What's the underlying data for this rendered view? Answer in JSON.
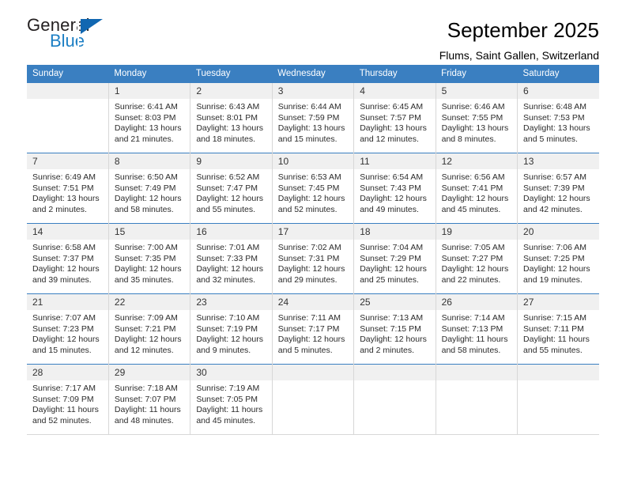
{
  "brand": {
    "name_part1": "General",
    "name_part2": "Blue",
    "accent_color": "#1167b1",
    "blue_text_color": "#1c7fc4"
  },
  "header": {
    "title": "September 2025",
    "subtitle": "Flums, Saint Gallen, Switzerland"
  },
  "calendar": {
    "header_bg": "#3a7fc1",
    "daynum_bg": "#f0f0f0",
    "weekday_headers": [
      "Sunday",
      "Monday",
      "Tuesday",
      "Wednesday",
      "Thursday",
      "Friday",
      "Saturday"
    ],
    "weeks": [
      [
        {
          "day": "",
          "sunrise": "",
          "sunset": "",
          "daylight_line1": "",
          "daylight_line2": ""
        },
        {
          "day": "1",
          "sunrise": "Sunrise: 6:41 AM",
          "sunset": "Sunset: 8:03 PM",
          "daylight_line1": "Daylight: 13 hours",
          "daylight_line2": "and 21 minutes."
        },
        {
          "day": "2",
          "sunrise": "Sunrise: 6:43 AM",
          "sunset": "Sunset: 8:01 PM",
          "daylight_line1": "Daylight: 13 hours",
          "daylight_line2": "and 18 minutes."
        },
        {
          "day": "3",
          "sunrise": "Sunrise: 6:44 AM",
          "sunset": "Sunset: 7:59 PM",
          "daylight_line1": "Daylight: 13 hours",
          "daylight_line2": "and 15 minutes."
        },
        {
          "day": "4",
          "sunrise": "Sunrise: 6:45 AM",
          "sunset": "Sunset: 7:57 PM",
          "daylight_line1": "Daylight: 13 hours",
          "daylight_line2": "and 12 minutes."
        },
        {
          "day": "5",
          "sunrise": "Sunrise: 6:46 AM",
          "sunset": "Sunset: 7:55 PM",
          "daylight_line1": "Daylight: 13 hours",
          "daylight_line2": "and 8 minutes."
        },
        {
          "day": "6",
          "sunrise": "Sunrise: 6:48 AM",
          "sunset": "Sunset: 7:53 PM",
          "daylight_line1": "Daylight: 13 hours",
          "daylight_line2": "and 5 minutes."
        }
      ],
      [
        {
          "day": "7",
          "sunrise": "Sunrise: 6:49 AM",
          "sunset": "Sunset: 7:51 PM",
          "daylight_line1": "Daylight: 13 hours",
          "daylight_line2": "and 2 minutes."
        },
        {
          "day": "8",
          "sunrise": "Sunrise: 6:50 AM",
          "sunset": "Sunset: 7:49 PM",
          "daylight_line1": "Daylight: 12 hours",
          "daylight_line2": "and 58 minutes."
        },
        {
          "day": "9",
          "sunrise": "Sunrise: 6:52 AM",
          "sunset": "Sunset: 7:47 PM",
          "daylight_line1": "Daylight: 12 hours",
          "daylight_line2": "and 55 minutes."
        },
        {
          "day": "10",
          "sunrise": "Sunrise: 6:53 AM",
          "sunset": "Sunset: 7:45 PM",
          "daylight_line1": "Daylight: 12 hours",
          "daylight_line2": "and 52 minutes."
        },
        {
          "day": "11",
          "sunrise": "Sunrise: 6:54 AM",
          "sunset": "Sunset: 7:43 PM",
          "daylight_line1": "Daylight: 12 hours",
          "daylight_line2": "and 49 minutes."
        },
        {
          "day": "12",
          "sunrise": "Sunrise: 6:56 AM",
          "sunset": "Sunset: 7:41 PM",
          "daylight_line1": "Daylight: 12 hours",
          "daylight_line2": "and 45 minutes."
        },
        {
          "day": "13",
          "sunrise": "Sunrise: 6:57 AM",
          "sunset": "Sunset: 7:39 PM",
          "daylight_line1": "Daylight: 12 hours",
          "daylight_line2": "and 42 minutes."
        }
      ],
      [
        {
          "day": "14",
          "sunrise": "Sunrise: 6:58 AM",
          "sunset": "Sunset: 7:37 PM",
          "daylight_line1": "Daylight: 12 hours",
          "daylight_line2": "and 39 minutes."
        },
        {
          "day": "15",
          "sunrise": "Sunrise: 7:00 AM",
          "sunset": "Sunset: 7:35 PM",
          "daylight_line1": "Daylight: 12 hours",
          "daylight_line2": "and 35 minutes."
        },
        {
          "day": "16",
          "sunrise": "Sunrise: 7:01 AM",
          "sunset": "Sunset: 7:33 PM",
          "daylight_line1": "Daylight: 12 hours",
          "daylight_line2": "and 32 minutes."
        },
        {
          "day": "17",
          "sunrise": "Sunrise: 7:02 AM",
          "sunset": "Sunset: 7:31 PM",
          "daylight_line1": "Daylight: 12 hours",
          "daylight_line2": "and 29 minutes."
        },
        {
          "day": "18",
          "sunrise": "Sunrise: 7:04 AM",
          "sunset": "Sunset: 7:29 PM",
          "daylight_line1": "Daylight: 12 hours",
          "daylight_line2": "and 25 minutes."
        },
        {
          "day": "19",
          "sunrise": "Sunrise: 7:05 AM",
          "sunset": "Sunset: 7:27 PM",
          "daylight_line1": "Daylight: 12 hours",
          "daylight_line2": "and 22 minutes."
        },
        {
          "day": "20",
          "sunrise": "Sunrise: 7:06 AM",
          "sunset": "Sunset: 7:25 PM",
          "daylight_line1": "Daylight: 12 hours",
          "daylight_line2": "and 19 minutes."
        }
      ],
      [
        {
          "day": "21",
          "sunrise": "Sunrise: 7:07 AM",
          "sunset": "Sunset: 7:23 PM",
          "daylight_line1": "Daylight: 12 hours",
          "daylight_line2": "and 15 minutes."
        },
        {
          "day": "22",
          "sunrise": "Sunrise: 7:09 AM",
          "sunset": "Sunset: 7:21 PM",
          "daylight_line1": "Daylight: 12 hours",
          "daylight_line2": "and 12 minutes."
        },
        {
          "day": "23",
          "sunrise": "Sunrise: 7:10 AM",
          "sunset": "Sunset: 7:19 PM",
          "daylight_line1": "Daylight: 12 hours",
          "daylight_line2": "and 9 minutes."
        },
        {
          "day": "24",
          "sunrise": "Sunrise: 7:11 AM",
          "sunset": "Sunset: 7:17 PM",
          "daylight_line1": "Daylight: 12 hours",
          "daylight_line2": "and 5 minutes."
        },
        {
          "day": "25",
          "sunrise": "Sunrise: 7:13 AM",
          "sunset": "Sunset: 7:15 PM",
          "daylight_line1": "Daylight: 12 hours",
          "daylight_line2": "and 2 minutes."
        },
        {
          "day": "26",
          "sunrise": "Sunrise: 7:14 AM",
          "sunset": "Sunset: 7:13 PM",
          "daylight_line1": "Daylight: 11 hours",
          "daylight_line2": "and 58 minutes."
        },
        {
          "day": "27",
          "sunrise": "Sunrise: 7:15 AM",
          "sunset": "Sunset: 7:11 PM",
          "daylight_line1": "Daylight: 11 hours",
          "daylight_line2": "and 55 minutes."
        }
      ],
      [
        {
          "day": "28",
          "sunrise": "Sunrise: 7:17 AM",
          "sunset": "Sunset: 7:09 PM",
          "daylight_line1": "Daylight: 11 hours",
          "daylight_line2": "and 52 minutes."
        },
        {
          "day": "29",
          "sunrise": "Sunrise: 7:18 AM",
          "sunset": "Sunset: 7:07 PM",
          "daylight_line1": "Daylight: 11 hours",
          "daylight_line2": "and 48 minutes."
        },
        {
          "day": "30",
          "sunrise": "Sunrise: 7:19 AM",
          "sunset": "Sunset: 7:05 PM",
          "daylight_line1": "Daylight: 11 hours",
          "daylight_line2": "and 45 minutes."
        },
        {
          "day": "",
          "sunrise": "",
          "sunset": "",
          "daylight_line1": "",
          "daylight_line2": ""
        },
        {
          "day": "",
          "sunrise": "",
          "sunset": "",
          "daylight_line1": "",
          "daylight_line2": ""
        },
        {
          "day": "",
          "sunrise": "",
          "sunset": "",
          "daylight_line1": "",
          "daylight_line2": ""
        },
        {
          "day": "",
          "sunrise": "",
          "sunset": "",
          "daylight_line1": "",
          "daylight_line2": ""
        }
      ]
    ]
  }
}
